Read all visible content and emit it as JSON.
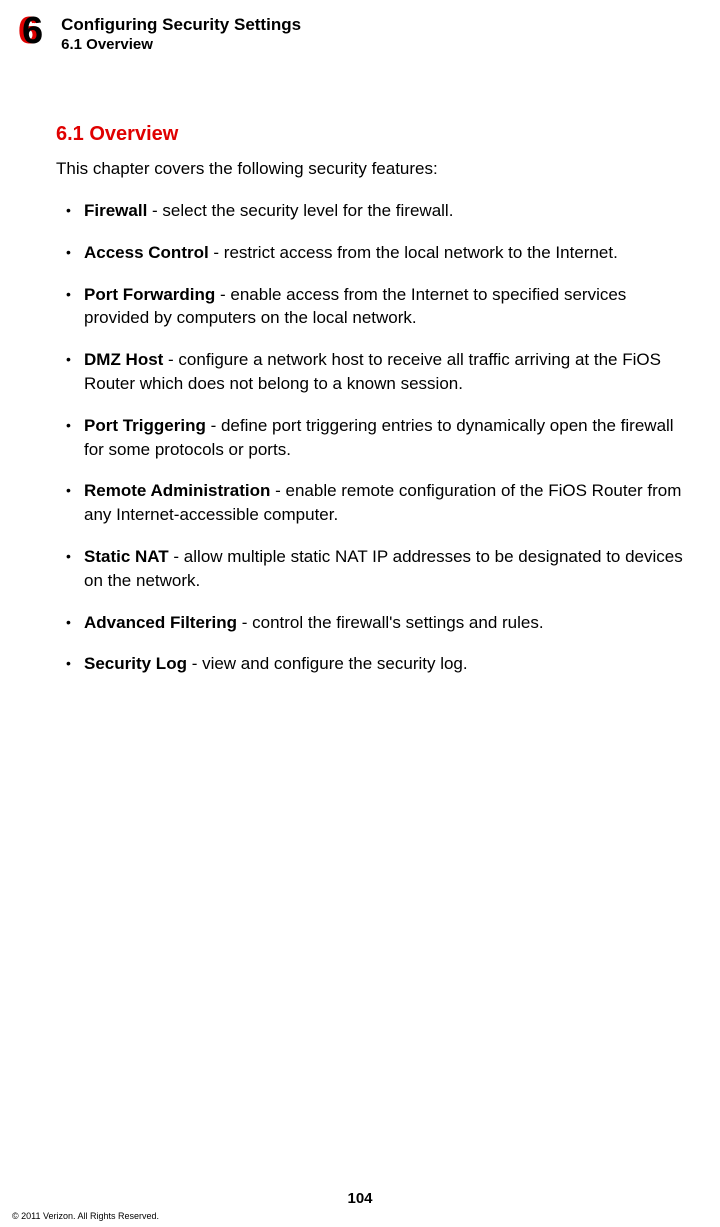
{
  "header": {
    "chapter_number": "6",
    "chapter_title": "Configuring Security Settings",
    "section_label": "6.1  Overview"
  },
  "content": {
    "section_heading": "6.1  Overview",
    "intro": "This chapter covers the following security features:",
    "features": [
      {
        "term": "Firewall",
        "desc": " - select the security level for the firewall."
      },
      {
        "term": "Access Control",
        "desc": " - restrict access from the local network to the Internet."
      },
      {
        "term": "Port Forwarding",
        "desc": " - enable access from the Internet to specified services provided by computers on the local network."
      },
      {
        "term": "DMZ Host",
        "desc": " - configure a network host to receive all traffic arriving at the FiOS Router which does not belong to a known session."
      },
      {
        "term": "Port Triggering",
        "desc": " - define port triggering entries to dynamically open the firewall for some protocols or ports."
      },
      {
        "term": "Remote Administration",
        "desc": " - enable remote configuration of the FiOS Router from any Internet-accessible computer."
      },
      {
        "term": "Static NAT",
        "desc": " - allow multiple static NAT IP addresses to be designated to devices on the network."
      },
      {
        "term": "Advanced Filtering",
        "desc": " - control the firewall's settings and rules."
      },
      {
        "term": "Security Log",
        "desc": " - view and configure the security log."
      }
    ]
  },
  "footer": {
    "page_number": "104",
    "copyright": "© 2011 Verizon. All Rights Reserved."
  }
}
